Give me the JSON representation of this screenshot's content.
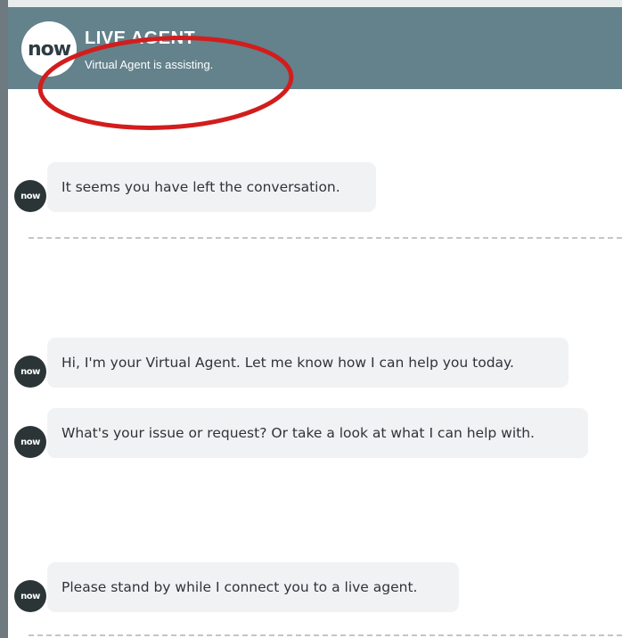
{
  "header": {
    "logo_text": "now",
    "title": "LIVE AGENT",
    "subtitle": "Virtual Agent is assisting."
  },
  "colors": {
    "header_bg": "#63828c",
    "bubble_bg": "#f1f2f4",
    "avatar_bg": "#2b3538",
    "annotation": "#d21d1d",
    "text": "#2f3438"
  },
  "messages": [
    {
      "avatar": "now",
      "text": "It seems you have left the conversation."
    },
    {
      "avatar": "now",
      "text": "Hi, I'm your Virtual Agent. Let me know how I can help you today."
    },
    {
      "avatar": "now",
      "text": "What's your issue or request? Or take a look at what I can help with."
    },
    {
      "avatar": "now",
      "text": "Please stand by while I connect you to a live agent."
    }
  ]
}
